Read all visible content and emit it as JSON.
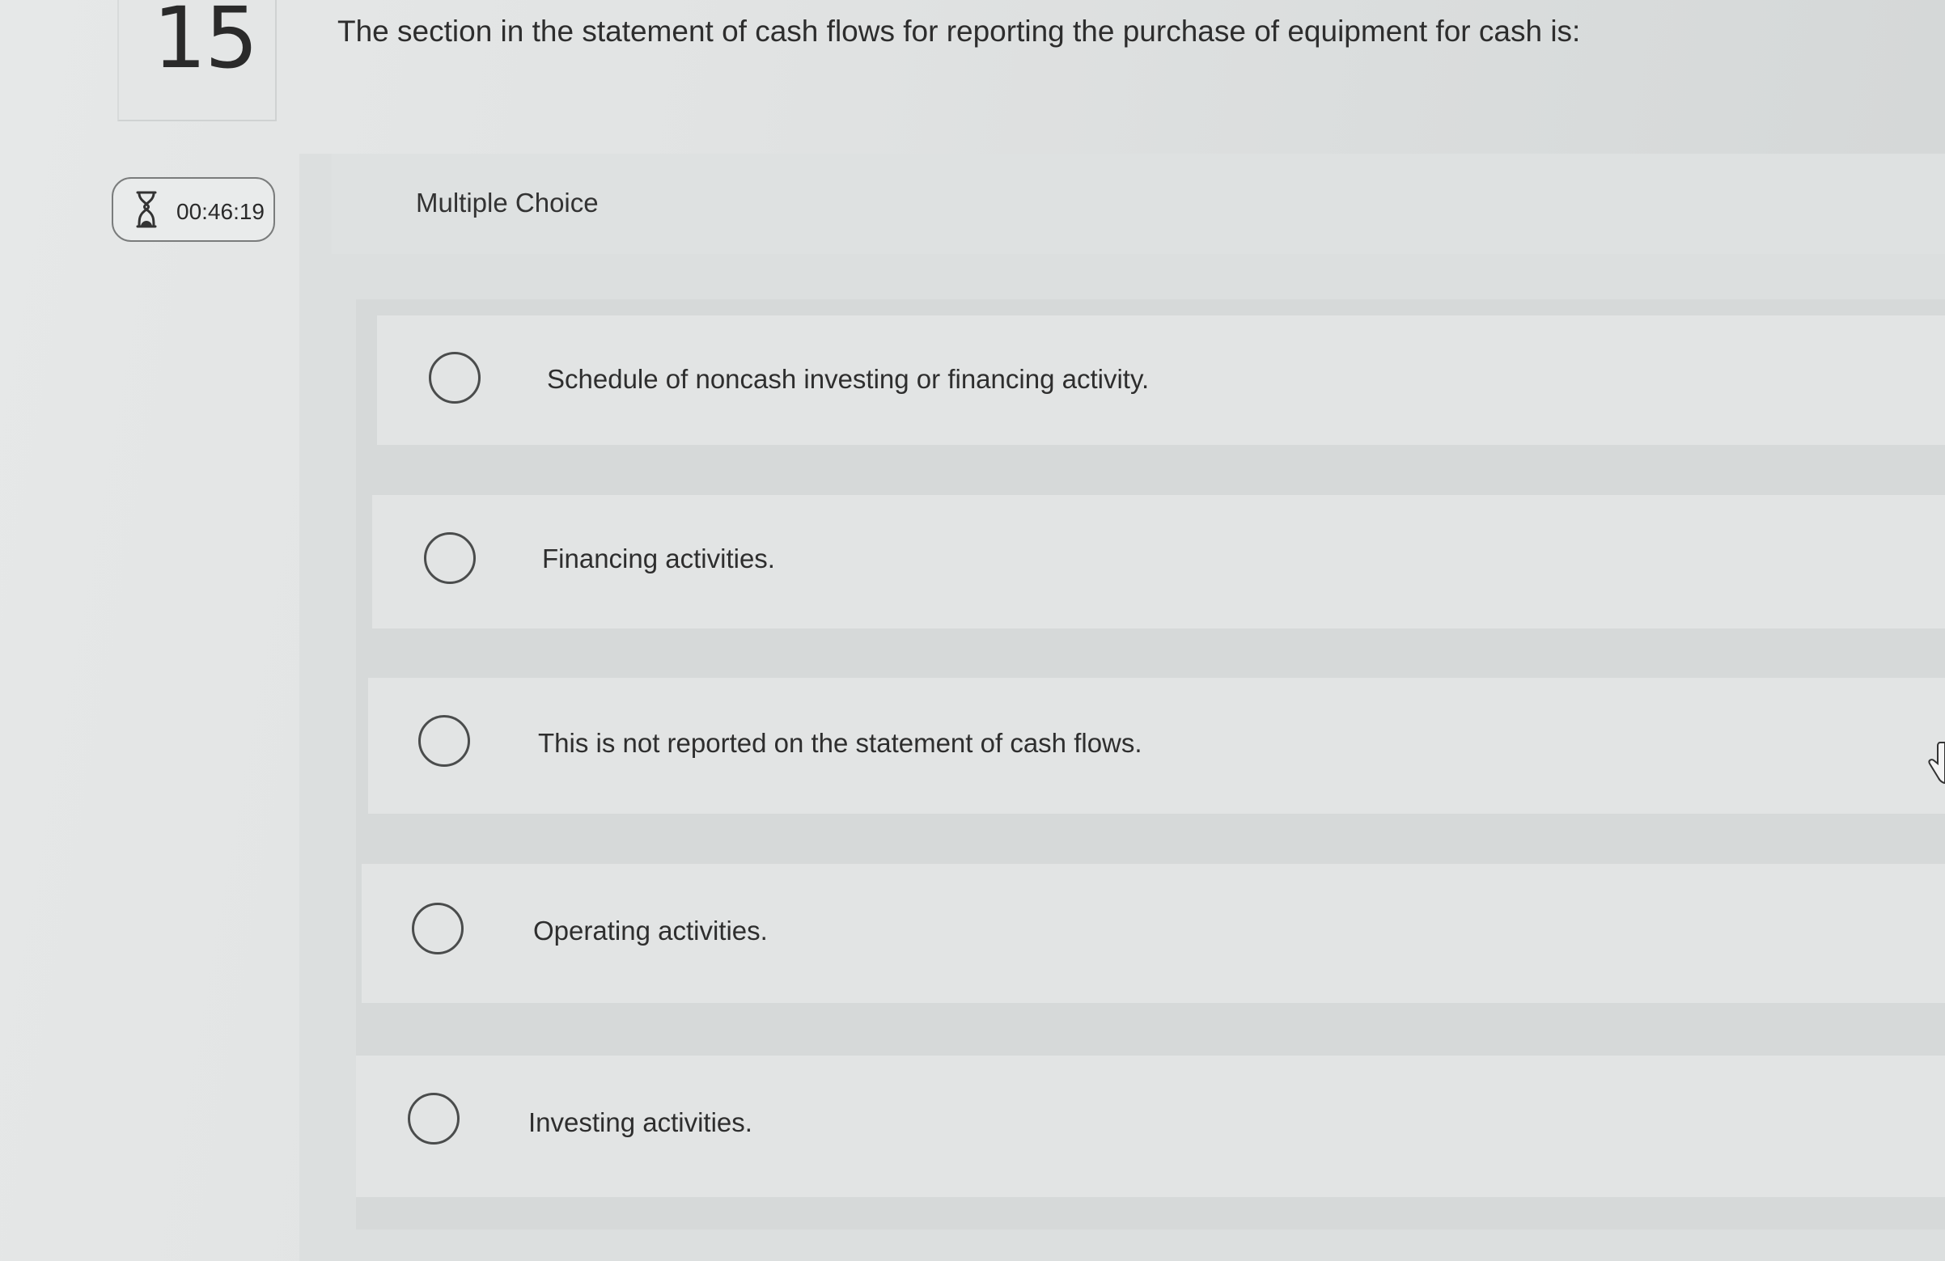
{
  "question": {
    "number": "15",
    "text": "The section in the statement of cash flows for reporting the purchase of equipment for cash is:"
  },
  "timer": {
    "icon": "hourglass-icon",
    "value": "00:46:19"
  },
  "question_type": "Multiple Choice",
  "options": [
    {
      "label": "Schedule of noncash investing or financing activity.",
      "selected": false
    },
    {
      "label": "Financing activities.",
      "selected": false
    },
    {
      "label": "This is not reported on the statement of cash flows.",
      "selected": false
    },
    {
      "label": "Operating activities.",
      "selected": false
    },
    {
      "label": "Investing activities.",
      "selected": false
    }
  ]
}
